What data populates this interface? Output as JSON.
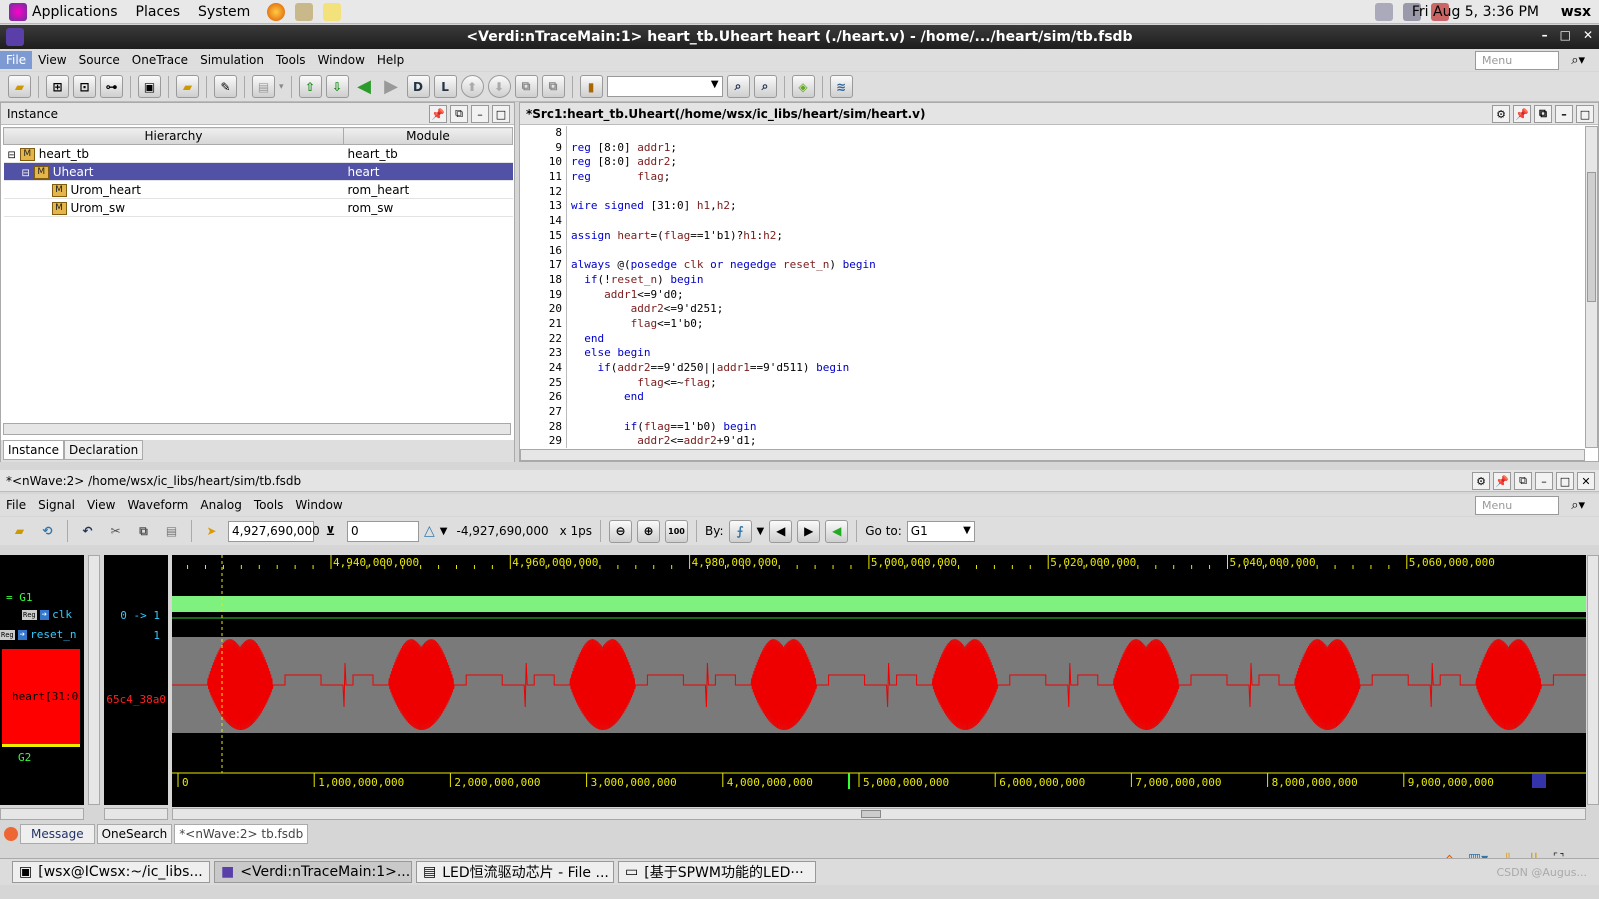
{
  "topbar": {
    "applications": "Applications",
    "places": "Places",
    "system": "System",
    "datetime": "Fri Aug  5,  3:36 PM",
    "user": "wsx"
  },
  "window": {
    "title": "<Verdi:nTraceMain:1> heart_tb.Uheart heart (./heart.v) - /home/.../heart/sim/tb.fsdb"
  },
  "menu": {
    "items": [
      "File",
      "View",
      "Source",
      "OneTrace",
      "Simulation",
      "Tools",
      "Window",
      "Help"
    ],
    "search_placeholder": "Menu"
  },
  "toolbar": {
    "d_label": "D",
    "l_label": "L"
  },
  "instance_panel": {
    "title": "Instance",
    "col_hierarchy": "Hierarchy",
    "col_module": "Module",
    "rows": [
      {
        "name": "heart_tb",
        "module": "heart_tb"
      },
      {
        "name": "Uheart",
        "module": "heart"
      },
      {
        "name": "Urom_heart",
        "module": "rom_heart"
      },
      {
        "name": "Urom_sw",
        "module": "rom_sw"
      }
    ],
    "tabs": [
      "Instance",
      "Declaration"
    ]
  },
  "source_panel": {
    "title": "*Src1:heart_tb.Uheart(/home/wsx/ic_libs/heart/sim/heart.v)"
  },
  "code": [
    {
      "n": "8",
      "t": ""
    },
    {
      "n": "9",
      "t": "reg [8:0] addr1;"
    },
    {
      "n": "10",
      "t": "reg [8:0] addr2;"
    },
    {
      "n": "11",
      "t": "reg       flag;"
    },
    {
      "n": "12",
      "t": ""
    },
    {
      "n": "13",
      "t": "wire signed [31:0] h1,h2;"
    },
    {
      "n": "14",
      "t": ""
    },
    {
      "n": "15",
      "t": "assign heart=(flag==1'b1)?h1:h2;"
    },
    {
      "n": "16",
      "t": ""
    },
    {
      "n": "17",
      "t": "always @(posedge clk or negedge reset_n) begin"
    },
    {
      "n": "18",
      "t": "  if(!reset_n) begin"
    },
    {
      "n": "19",
      "t": "     addr1<=9'd0;"
    },
    {
      "n": "20",
      "t": "         addr2<=9'd251;"
    },
    {
      "n": "21",
      "t": "         flag<=1'b0;"
    },
    {
      "n": "22",
      "t": "  end"
    },
    {
      "n": "23",
      "t": "  else begin"
    },
    {
      "n": "24",
      "t": "    if(addr2==9'd250||addr1==9'd511) begin"
    },
    {
      "n": "25",
      "t": "          flag<=~flag;"
    },
    {
      "n": "26",
      "t": "        end"
    },
    {
      "n": "27",
      "t": ""
    },
    {
      "n": "28",
      "t": "        if(flag==1'b0) begin"
    },
    {
      "n": "29",
      "t": "          addr2<=addr2+9'd1;"
    }
  ],
  "nwave": {
    "title": "*<nWave:2> /home/wsx/ic_libs/heart/sim/tb.fsdb",
    "menu": [
      "File",
      "Signal",
      "View",
      "Waveform",
      "Analog",
      "Tools",
      "Window"
    ],
    "search_placeholder": "Menu",
    "cursor_time": "4,927,690,000",
    "marker_time": "0",
    "delta": "-4,927,690,000",
    "unit": "x 1ps",
    "by_label": "By:",
    "goto_label": "Go to:",
    "goto_value": "G1",
    "group1": "G1",
    "group2": "G2",
    "signals": [
      {
        "name": "clk",
        "value": "0 -> 1"
      },
      {
        "name": "reset_n",
        "value": "1"
      },
      {
        "name": "heart[31:0]",
        "value": "65c4_38a0"
      }
    ],
    "top_ticks": [
      "4,940,000,000",
      "4,960,000,000",
      "4,980,000,000",
      "5,000,000,000",
      "5,020,000,000",
      "5,040,000,000",
      "5,060,000,000"
    ],
    "bottom_ticks": [
      "0",
      "1,000,000,000",
      "2,000,000,000",
      "3,000,000,000",
      "4,000,000,000",
      "5,000,000,000",
      "6,000,000,000",
      "7,000,000,000",
      "8,000,000,000",
      "9,000,000,000"
    ]
  },
  "bottom_tabs": [
    "Message",
    "OneSearch",
    "*<nWave:2> tb.fsdb"
  ],
  "taskbar": [
    "[wsx@ICwsx:~/ic_libs...",
    "<Verdi:nTraceMain:1>...",
    "LED恒流驱动芯片 - File ...",
    "[基于SPWM功能的LED···"
  ],
  "watermark": "CSDN @Augus..."
}
